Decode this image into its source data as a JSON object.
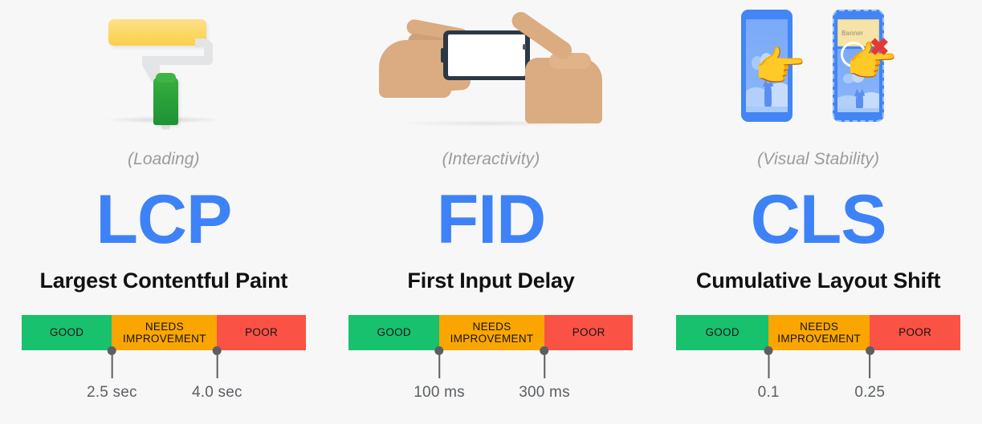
{
  "theme": {
    "background": "#f7f7f7",
    "accent_blue": "#3e82f7",
    "good_color": "#18c16e",
    "needs_color": "#fba600",
    "poor_color": "#fb5246",
    "pin_color": "#5b5f63",
    "category_color": "#9b9b9b",
    "title_color": "#111111"
  },
  "panels": [
    {
      "illustration": "paint-roller",
      "category": "(Loading)",
      "acronym": "LCP",
      "fullname": "Largest Contentful Paint",
      "bar": {
        "segments": [
          {
            "label": "GOOD",
            "width_pct": 31.8
          },
          {
            "label": "NEEDS\nIMPROVEMENT",
            "width_pct": 37.0
          },
          {
            "label": "POOR",
            "width_pct": 31.2
          }
        ],
        "thresholds": [
          {
            "label": "2.5 sec",
            "position_pct": 31.8
          },
          {
            "label": "4.0 sec",
            "position_pct": 68.8
          }
        ]
      }
    },
    {
      "illustration": "hand-tapping-phone",
      "category": "(Interactivity)",
      "acronym": "FID",
      "fullname": "First Input Delay",
      "bar": {
        "segments": [
          {
            "label": "GOOD",
            "width_pct": 31.8
          },
          {
            "label": "NEEDS\nIMPROVEMENT",
            "width_pct": 37.0
          },
          {
            "label": "POOR",
            "width_pct": 31.2
          }
        ],
        "thresholds": [
          {
            "label": "100 ms",
            "position_pct": 31.8
          },
          {
            "label": "300 ms",
            "position_pct": 68.8
          }
        ]
      }
    },
    {
      "illustration": "layout-shift-phones",
      "category": "(Visual Stability)",
      "acronym": "CLS",
      "fullname": "Cumulative Layout Shift",
      "banner_label": "Banner",
      "bar": {
        "segments": [
          {
            "label": "GOOD",
            "width_pct": 32.5
          },
          {
            "label": "NEEDS\nIMPROVEMENT",
            "width_pct": 35.6
          },
          {
            "label": "POOR",
            "width_pct": 31.9
          }
        ],
        "thresholds": [
          {
            "label": "0.1",
            "position_pct": 32.5
          },
          {
            "label": "0.25",
            "position_pct": 68.1
          }
        ]
      }
    }
  ]
}
